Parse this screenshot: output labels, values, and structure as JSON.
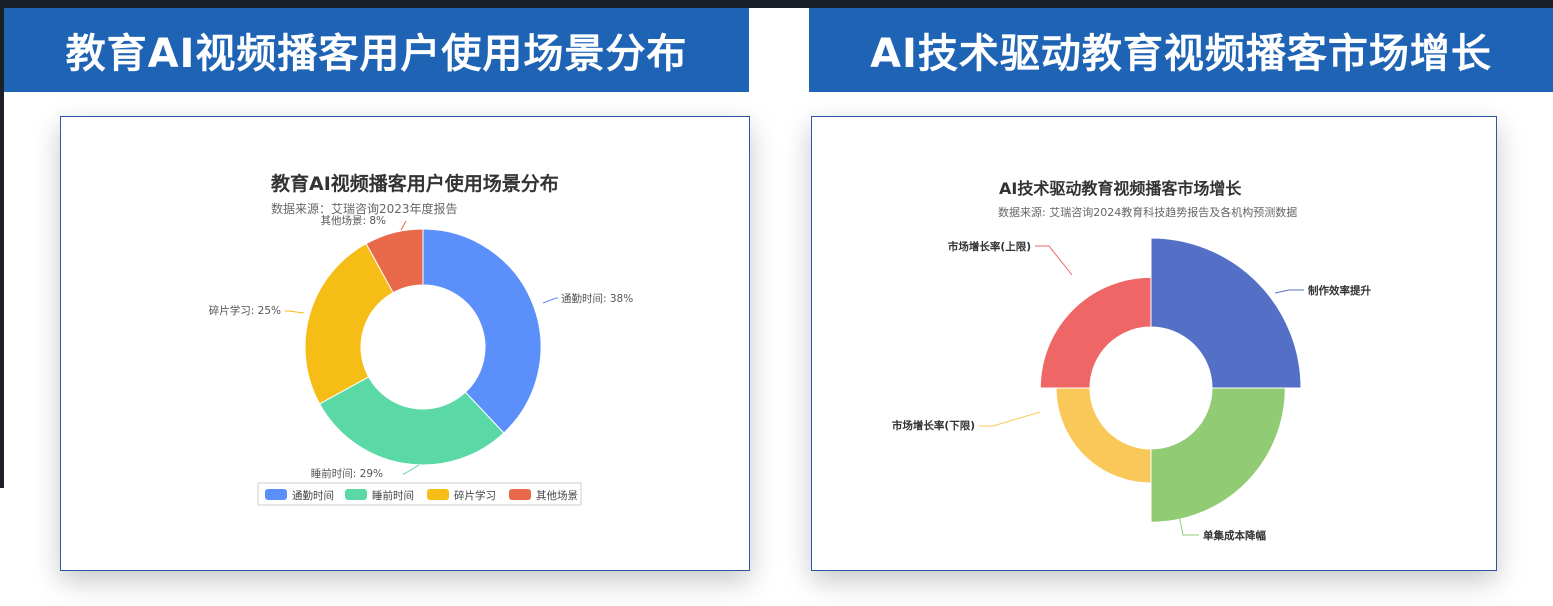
{
  "banners": {
    "left": "教育AI视频播客用户使用场景分布",
    "right": "AI技术驱动教育视频播客市场增长"
  },
  "chart_data": [
    {
      "type": "pie",
      "variant": "donut",
      "title": "教育AI视频播客用户使用场景分布",
      "subtitle": "数据来源：艾瑞咨询2023年度报告",
      "series": [
        {
          "values": [
            38,
            29,
            25,
            8
          ]
        }
      ],
      "categories": [
        "通勤时间",
        "睡前时间",
        "碎片学习",
        "其他场景"
      ],
      "data_labels": [
        "通勤时间: 38%",
        "睡前时间: 29%",
        "碎片学习: 25%",
        "其他场景: 8%"
      ],
      "colors": [
        "#5b8ff9",
        "#5ad8a6",
        "#f6bd16",
        "#e8684a"
      ],
      "legend": "bottom"
    },
    {
      "type": "pie",
      "variant": "rose",
      "title": "AI技术驱动教育视频播客市场增长",
      "subtitle": "数据来源: 艾瑞咨询2024教育科技趋势报告及各机构预测数据",
      "categories": [
        "制作效率提升",
        "单集成本降幅",
        "市场增长率(下限)",
        "市场增长率(上限)"
      ],
      "values": [
        70,
        60,
        35,
        45
      ],
      "colors": [
        "#5470c6",
        "#91cc75",
        "#fac858",
        "#ee6666"
      ],
      "legend": "none"
    }
  ]
}
